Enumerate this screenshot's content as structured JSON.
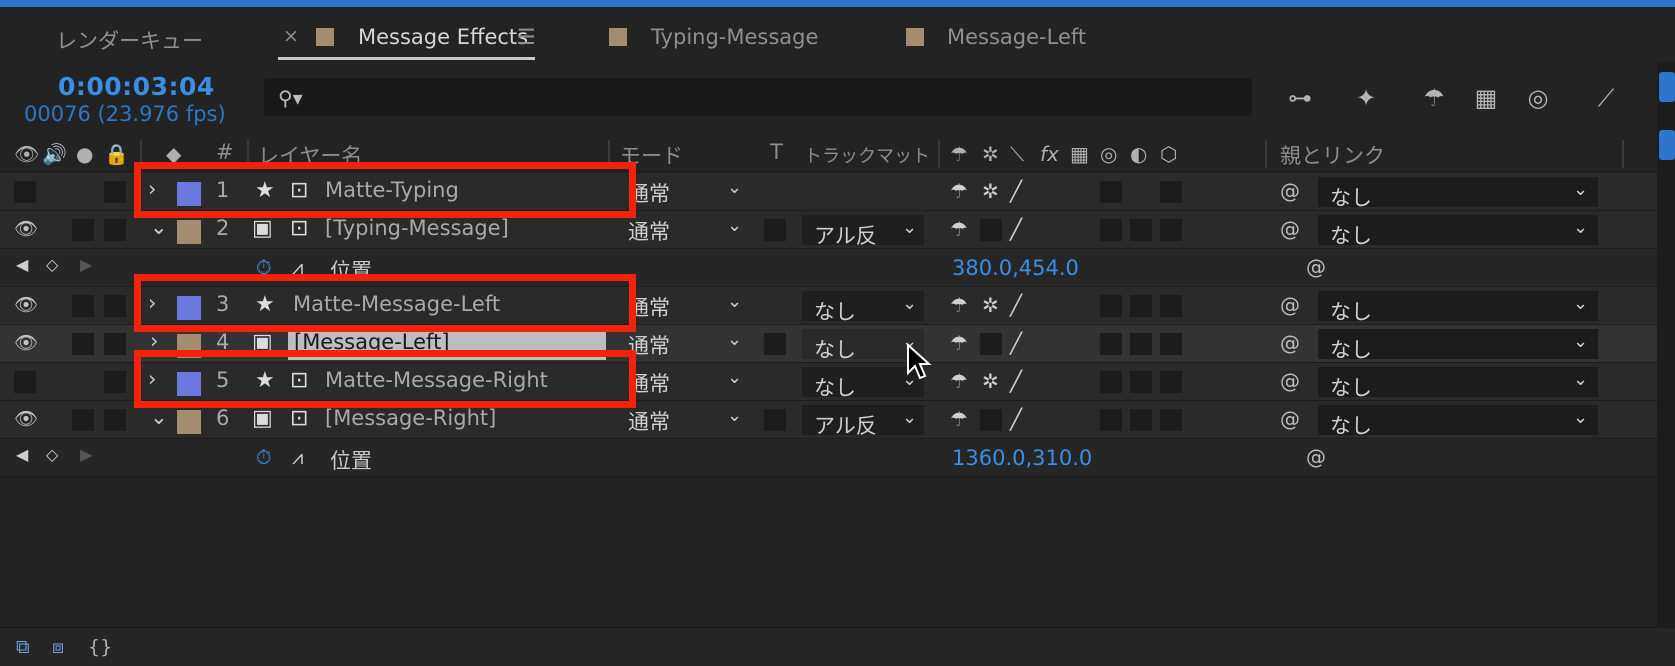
{
  "tabs": [
    {
      "label": "レンダーキュー"
    },
    {
      "label": "Message Effects",
      "active": true
    },
    {
      "label": "Typing-Message"
    },
    {
      "label": "Message-Left"
    }
  ],
  "timecode": "0:00:03:04",
  "frame_info": "00076 (23.976 fps)",
  "search": {
    "placeholder": ""
  },
  "columns": {
    "hash": "#",
    "layer_name": "レイヤー名",
    "mode": "モード",
    "t": "T",
    "track_matte": "トラックマット",
    "parent": "親とリンク"
  },
  "layers": [
    {
      "num": "1",
      "name": "Matte-Typing",
      "mode": "通常",
      "matte": "",
      "parent": "なし",
      "color": "#6b78dd"
    },
    {
      "num": "2",
      "name": "[Typing-Message]",
      "mode": "通常",
      "matte": "アル反",
      "parent": "なし",
      "color": "#a48c6e"
    },
    {
      "prop": "位置",
      "value": "380.0,454.0"
    },
    {
      "num": "3",
      "name": "Matte-Message-Left",
      "mode": "通常",
      "matte": "なし",
      "parent": "なし",
      "color": "#6b78dd"
    },
    {
      "num": "4",
      "name": "[Message-Left]",
      "mode": "通常",
      "matte": "なし",
      "parent": "なし",
      "color": "#a48c6e"
    },
    {
      "num": "5",
      "name": "Matte-Message-Right",
      "mode": "通常",
      "matte": "なし",
      "parent": "なし",
      "color": "#6b78dd"
    },
    {
      "num": "6",
      "name": "[Message-Right]",
      "mode": "通常",
      "matte": "アル反",
      "parent": "なし",
      "color": "#a48c6e"
    },
    {
      "prop": "位置",
      "value": "1360.0,310.0"
    }
  ],
  "highlight_color": "#f2230a",
  "accent": "#3a8ee6"
}
